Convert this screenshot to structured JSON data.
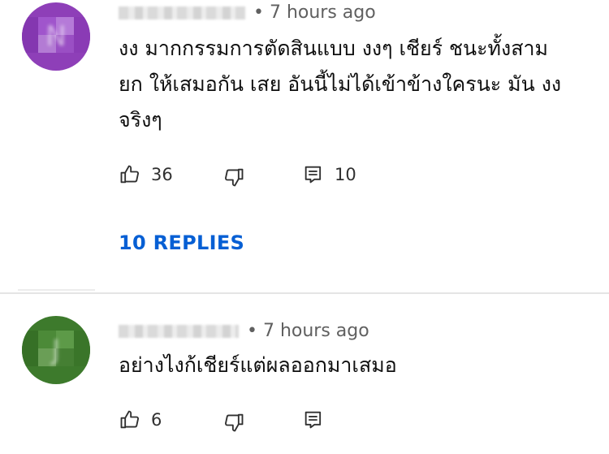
{
  "comments": [
    {
      "avatar_color": "#8e3fb8",
      "avatar_initial": "N",
      "time": "• 7 hours ago",
      "text": "งง มากกรรมการตัดสินแบบ งงๆ เชียร์ ชนะทั้งสาม\nยก ให้เสมอกัน เสย อันนี้ไม่ได้เข้าข้างใครนะ มัน งง\nจริงๆ",
      "likes": "36",
      "reply_count": "10",
      "replies_link": "10 REPLIES",
      "icons": {
        "like": "thumb-up-icon",
        "dislike": "thumb-down-icon",
        "reply": "reply-icon"
      }
    },
    {
      "avatar_color": "#3d7a2c",
      "avatar_initial": "J",
      "time": "• 7 hours ago",
      "text": "อย่างไงก้เชียร์แต่ผลออกมาเสมอ",
      "likes": "6",
      "icons": {
        "like": "thumb-up-icon",
        "dislike": "thumb-down-icon",
        "reply": "reply-icon"
      }
    }
  ],
  "colors": {
    "link": "#065fd4",
    "meta": "#606060",
    "text": "#0f0f0f"
  }
}
